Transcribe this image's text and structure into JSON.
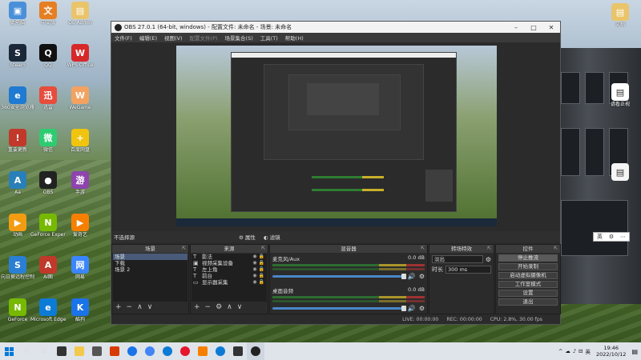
{
  "desktop": {
    "icons_left": [
      {
        "label": "此电脑",
        "color": "#4a90d9",
        "glyph": "▣"
      },
      {
        "label": "Steam",
        "color": "#1b2838",
        "glyph": "S"
      },
      {
        "label": "360安全浏览器",
        "color": "#1f7ad1",
        "glyph": "e"
      },
      {
        "label": "重要更新",
        "color": "#c0392b",
        "glyph": "!"
      },
      {
        "label": "Aa",
        "color": "#2980b9",
        "glyph": "A"
      },
      {
        "label": "动画",
        "color": "#f39c12",
        "glyph": "▶"
      },
      {
        "label": "向日葵远程控制",
        "color": "#2a7fd4",
        "glyph": "S"
      },
      {
        "label": "GeForce",
        "color": "#76b900",
        "glyph": "N"
      }
    ],
    "icons_col2": [
      {
        "label": "中文版",
        "color": "#e67e22",
        "glyph": "文"
      },
      {
        "label": "QQ",
        "color": "#111",
        "glyph": "Q"
      },
      {
        "label": "迅雷",
        "color": "#e74c3c",
        "glyph": "迅"
      },
      {
        "label": "微信",
        "color": "#2ecc71",
        "glyph": "微"
      },
      {
        "label": "OBS",
        "color": "#222",
        "glyph": "●"
      },
      {
        "label": "GeForce Experience",
        "color": "#76b900",
        "glyph": "N"
      },
      {
        "label": "AI图",
        "color": "#c0392b",
        "glyph": "A"
      },
      {
        "label": "Microsoft Edge",
        "color": "#0c7bd6",
        "glyph": "e"
      }
    ],
    "icons_col3": [
      {
        "label": "OE Admin",
        "color": "#e9c46a",
        "glyph": "▤"
      },
      {
        "label": "WPS Office",
        "color": "#d62828",
        "glyph": "W"
      },
      {
        "label": "WeGame",
        "color": "#f4a261",
        "glyph": "W"
      },
      {
        "label": "百度网盘",
        "color": "#f1c40f",
        "glyph": "+"
      },
      {
        "label": "手游",
        "color": "#8e44ad",
        "glyph": "游"
      },
      {
        "label": "爱奇艺",
        "color": "#f77f00",
        "glyph": "▶"
      },
      {
        "label": "网易",
        "color": "#3a86ff",
        "glyph": "网"
      },
      {
        "label": "酷狗",
        "color": "#1a73e8",
        "glyph": "K"
      }
    ],
    "icons_right": [
      {
        "label": "文档",
        "color": "#e9c46a",
        "glyph": "▤"
      },
      {
        "label": "请看正视",
        "color": "#fff",
        "glyph": "▤"
      },
      {
        "label": "",
        "color": "#f5f5f5",
        "glyph": "▤"
      }
    ],
    "ime": {
      "labels": [
        "英",
        "⚙",
        "⋯"
      ]
    }
  },
  "obs": {
    "title": "OBS 27.0.1 (64-bit, windows) - 配置文件: 未命名 - 场景: 未命名",
    "menu": [
      "文件(F)",
      "编辑(E)",
      "视图(V)",
      "配置文件(P)",
      "场景集合(S)",
      "工具(T)",
      "帮助(H)"
    ],
    "toolbar": {
      "no_source": "不选择源",
      "properties": "属性",
      "filters": "滤镜"
    },
    "scenes": {
      "title": "场景",
      "items": [
        "场景",
        "下载",
        "场景 2"
      ]
    },
    "sources": {
      "title": "来源",
      "items": [
        {
          "icon": "T",
          "label": "影法"
        },
        {
          "icon": "▣",
          "label": "视频采集设备"
        },
        {
          "icon": "T",
          "label": "左上角"
        },
        {
          "icon": "T",
          "label": "前台"
        },
        {
          "icon": "▭",
          "label": "显示器采集"
        }
      ]
    },
    "mixer": {
      "title": "混音器",
      "channels": [
        {
          "name": "麦克风/Aux",
          "db": "0.0 dB"
        },
        {
          "name": "桌面音频",
          "db": "0.0 dB"
        }
      ]
    },
    "transitions": {
      "title": "转场特效",
      "type": "淡出",
      "duration_label": "时长",
      "duration_value": "300 ms"
    },
    "controls": {
      "title": "控件",
      "buttons": [
        "停止推流",
        "开始录制",
        "启动虚拟摄像机",
        "工作室模式",
        "设置",
        "退出"
      ]
    },
    "status": {
      "live": "LIVE: 00:00:00",
      "rec": "REC: 00:00:00",
      "cpu": "CPU: 2.8%, 30.00 fps"
    }
  },
  "taskbar": {
    "clock_time": "19:46",
    "clock_date": "2022/10/12",
    "lang": "英",
    "tray_icons": [
      "^",
      "☁",
      "♪",
      "⊟"
    ]
  }
}
